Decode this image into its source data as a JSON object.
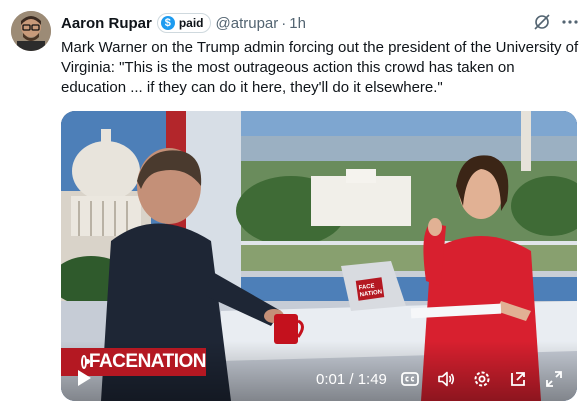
{
  "author": {
    "name": "Aaron Rupar",
    "badge_label": "paid",
    "badge_symbol": "$",
    "handle": "@atrupar",
    "separator": "·",
    "time": "1h"
  },
  "tweet": {
    "text": "Mark Warner on the Trump admin forcing out the president of the University of Virginia: \"This is the most outrageous action this crowd has taken on education ... if they can do it here, they'll do it elsewhere.\""
  },
  "video": {
    "logo_left": "FACE",
    "logo_right": "NATION",
    "laptop_logo_top": "FACE",
    "laptop_logo_bottom": "NATION",
    "time_display": "0:01 / 1:49",
    "icons": [
      "play-icon",
      "captions-icon",
      "volume-icon",
      "settings-icon",
      "pop-out-icon",
      "fullscreen-icon"
    ]
  },
  "colors": {
    "link_blue": "#1d9bf0",
    "brand_red": "#b41822",
    "text_secondary": "#536471"
  }
}
